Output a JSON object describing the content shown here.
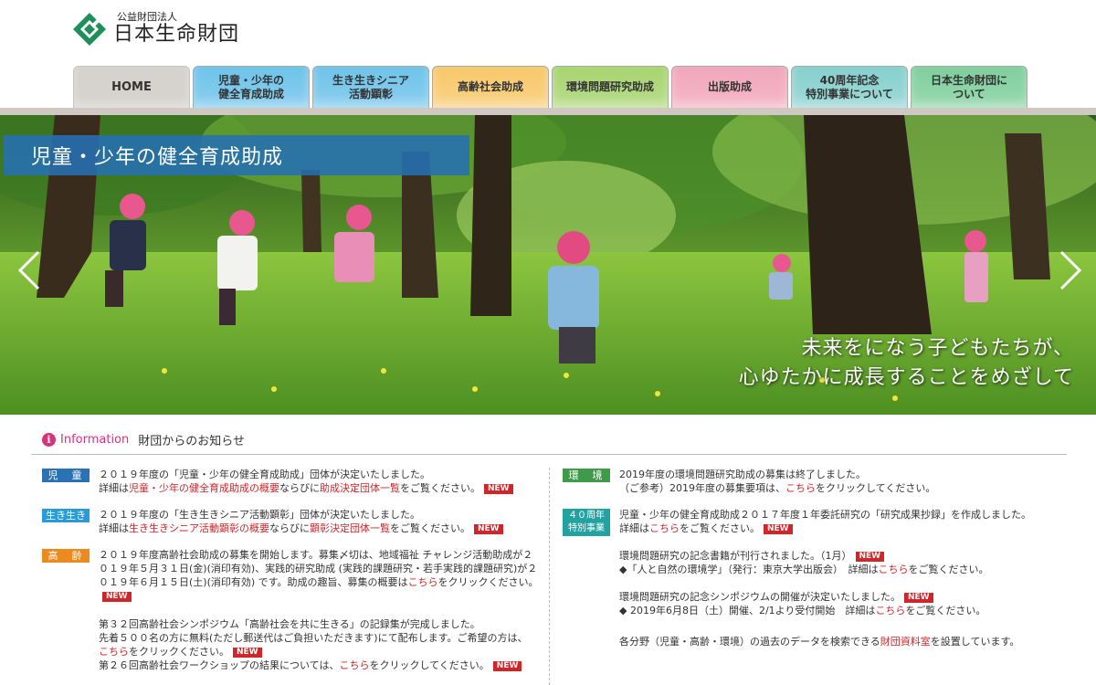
{
  "logo": {
    "sub": "公益財団法人",
    "main": "日本生命財団"
  },
  "nav": {
    "tabs": [
      {
        "label": "HOME",
        "color": "#d6d2ce"
      },
      {
        "label": "児童・少年の\n健全育成助成",
        "color": "#6ec3ea"
      },
      {
        "label": "生き生きシニア\n活動顕彰",
        "color": "#6ec3ea"
      },
      {
        "label": "高齢社会助成",
        "color": "#f8c86a"
      },
      {
        "label": "環境問題研究助成",
        "color": "#a7d46f"
      },
      {
        "label": "出版助成",
        "color": "#f2a6bb"
      },
      {
        "label": "40周年記念\n特別事業について",
        "color": "#86d0cd"
      },
      {
        "label": "日本生命財団に\nついて",
        "color": "#7ecf9c"
      }
    ]
  },
  "hero": {
    "title": "児童・少年の健全育成助成",
    "caption_line1": "未来をになう子どもたちが、",
    "caption_line2": "心ゆたかに成長することをめざして",
    "prev_icon": "chevron-left-icon",
    "next_icon": "chevron-right-icon"
  },
  "info": {
    "icon": "info-icon",
    "label": "Information",
    "heading": "財団からのお知らせ"
  },
  "left_news": [
    {
      "badge": "児　童",
      "badge_color": "#2b72b5",
      "line1": "２０１９年度の「児童・少年の健全育成助成」団体が決定いたしました。",
      "pre": "詳細は",
      "link1": "児童・少年の健全育成助成の概要",
      "mid": "ならびに",
      "link2": "助成決定団体一覧",
      "post": "をご覧ください。",
      "new": "NEW"
    },
    {
      "badge": "生き生き",
      "badge_color": "#2a9bd6",
      "line1": "２０１９年度の「生き生きシニア活動顕彰」団体が決定いたしました。",
      "pre": "詳細は",
      "link1": "生き生きシニア活動顕彰の概要",
      "mid": "ならびに",
      "link2": "顕彰決定団体一覧",
      "post": "をご覧ください。",
      "new": "NEW"
    },
    {
      "badge": "高　齢",
      "badge_color": "#ea8a1f",
      "para1": "２０１９年度高齢社会助成の募集を開始します。募集〆切は、地域福祉 チャレンジ活動助成が２０１９年５月３１日(金)(消印有効)、実践的研究助成 (実践的課題研究・若手実践的課題研究)が２０１９年６月１５日(土)(消印有効) です。助成の趣旨、募集の概要は",
      "para1_link": "こちら",
      "para1_post": "をクリックください。",
      "para2_line1": "第３２回高齢社会シンポジウム「高齢社会を共に生きる」の記録集が完成しました。",
      "para2_line2": "先着５００名の方に無料(ただし郵送代はご負担いただきます)にて配布します。ご希望の方は、",
      "para2_link": "こちら",
      "para2_post": "をクリックください。",
      "para3_pre": "第２６回高齢社会ワークショップの結果については、",
      "para3_link": "こちら",
      "para3_post": "をクリックしてください。",
      "new": "NEW"
    }
  ],
  "right_news": [
    {
      "badge": "環　境",
      "badge_color": "#3f9a4a",
      "line1": "2019年度の環境問題研究助成の募集は終了しました。",
      "line2_pre": "（ご参考）2019年度の募集要項は、",
      "line2_link": "こちら",
      "line2_post": "をクリックしてください。"
    },
    {
      "badge_line1": "４０周年",
      "badge_line2": "特別事業",
      "badge_color": "#22a3a1",
      "line1": "児童・少年の健全育成助成２０１７年度１年委託研究の「研究成果抄録」を作成しました。",
      "line2_pre": "詳細は",
      "line2_link": "こちら",
      "line2_post": "をご覧ください。",
      "new": "NEW"
    },
    {
      "line1": "環境問題研究の記念書籍が刊行されました。（1月）",
      "line2_pre": "◆「人と自然の環境学」（発行：東京大学出版会）　詳細は",
      "line2_link": "こちら",
      "line2_post": "をご覧ください。",
      "new": "NEW"
    },
    {
      "line1": "環境問題研究の記念シンポジウムの開催が決定いたしました。",
      "line2_pre": "◆ 2019年6月8日（土）開催、2/1より受付開始　詳細は",
      "line2_link": "こちら",
      "line2_post": "をご覧ください。",
      "new": "NEW"
    },
    {
      "line1_pre": "各分野（児童・高齢・環境）の過去のデータを検索できる",
      "line1_link": "財団資料室",
      "line1_post": "を設置しています。"
    }
  ]
}
